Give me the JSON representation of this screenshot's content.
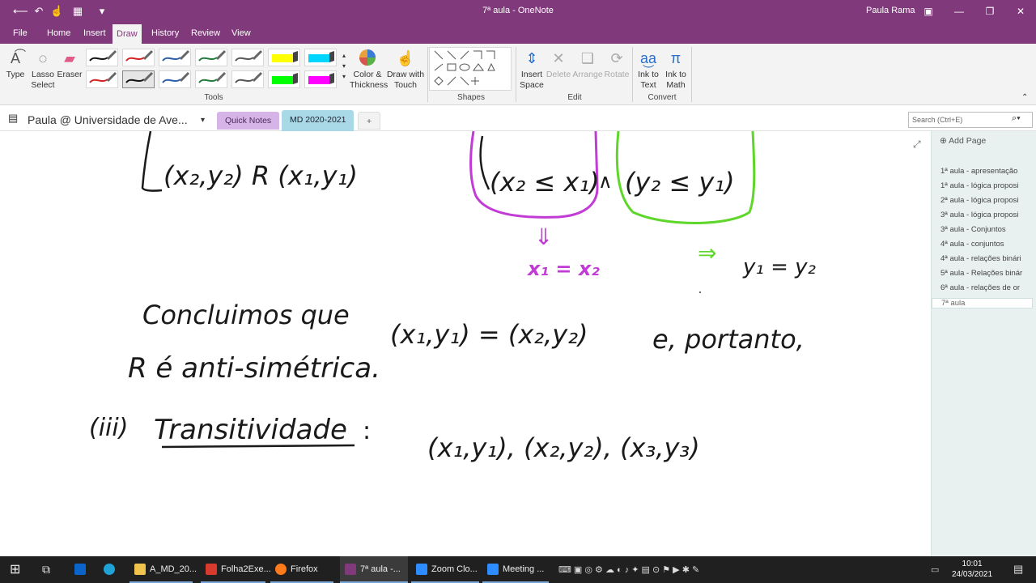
{
  "titlebar": {
    "title": "7ª aula  -  OneNote",
    "user": "Paula Rama"
  },
  "menu": [
    "File",
    "Home",
    "Insert",
    "Draw",
    "History",
    "Review",
    "View"
  ],
  "ribbon": {
    "type": "Type",
    "lasso": "Lasso",
    "lasso2": "Select",
    "eraser": "Eraser",
    "color_thickness": "Color &",
    "color_thickness2": "Thickness",
    "draw_touch": "Draw with",
    "draw_touch2": "Touch",
    "insert_space": "Insert",
    "insert_space2": "Space",
    "delete": "Delete",
    "arrange": "Arrange",
    "rotate": "Rotate",
    "ink_text": "Ink to",
    "ink_text2": "Text",
    "ink_math": "Ink to",
    "ink_math2": "Math",
    "groups": {
      "tools": "Tools",
      "shapes": "Shapes",
      "edit": "Edit",
      "convert": "Convert"
    },
    "pen_colors": [
      "#111111",
      "#d42020",
      "#2a5caa",
      "#1f7a3a",
      "#555555",
      "#ffff00",
      "#00d5ff",
      "#d42020",
      "#111111",
      "#2a5caa",
      "#1f7a3a",
      "#555555",
      "#00ff00",
      "#ff00ff"
    ]
  },
  "notebook": {
    "name": "Paula @ Universidade de Ave...",
    "sections": [
      "Quick Notes",
      "MD 2020-2021"
    ],
    "add": "+",
    "search_placeholder": "Search (Ctrl+E)"
  },
  "pages": {
    "add_label": "Add Page",
    "items": [
      "1ª aula - apresentação",
      "1ª aula - lógica proposi",
      "2ª aula - lógica proposi",
      "3ª aula - lógica proposi",
      "3ª aula - Conjuntos",
      "4ª aula - conjuntos",
      "4ª aula - relações binári",
      "5ª aula - Relações binár",
      "6ª aula - relações de or",
      "7ª aula"
    ]
  },
  "ink": {
    "l1": "(x₂,y₂) R (x₁,y₁)",
    "l2a": "(x₂ ≤ x₁)",
    "wedge": "∧",
    "l2b": "(y₂ ≤ y₁)",
    "arrow_down": "⇓",
    "eq1": "x₁ = x₂",
    "arrow_right": "⇒",
    "eq2": "y₁ = y₂",
    "l3": "Concluimos que",
    "l3b": "(x₁,y₁) = (x₂,y₂)",
    "l3c": "e, portanto,",
    "l4": "R é anti-simétrica.",
    "l5a": "(iii)",
    "l5b": "Transitividade",
    "l5c": ":",
    "l5d": "(x₁,y₁), (x₂,y₂), (x₃,y₃)",
    "colors": {
      "black": "#1a1a1a",
      "purple": "#c23bd6",
      "green": "#5ed62a"
    }
  },
  "taskbar": {
    "apps": [
      "A_MD_20...",
      "Folha2Exe...",
      "Firefox",
      "7ª aula  -...",
      "Zoom Clo...",
      "Meeting ..."
    ],
    "time": "10:01",
    "date": "24/03/2021"
  }
}
